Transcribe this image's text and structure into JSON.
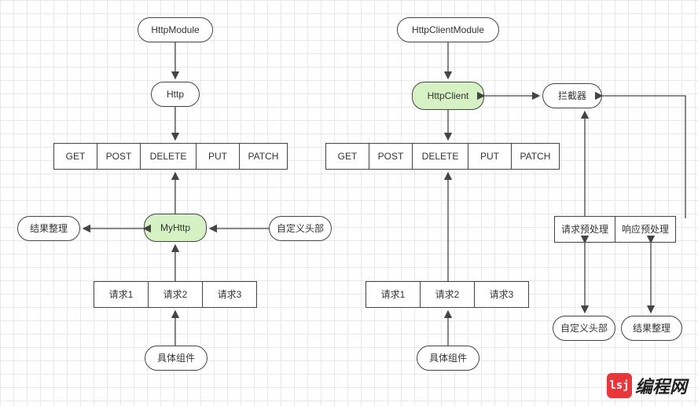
{
  "left": {
    "module": "HttpModule",
    "http": "Http",
    "methods": [
      "GET",
      "POST",
      "DELETE",
      "PUT",
      "PATCH"
    ],
    "myhttp": "MyHttp",
    "result_handling": "结果整理",
    "custom_header": "自定义头部",
    "requests": [
      "请求1",
      "请求2",
      "请求3"
    ],
    "component": "具体组件"
  },
  "right": {
    "module": "HttpClientModule",
    "client": "HttpClient",
    "interceptor": "拦截器",
    "methods": [
      "GET",
      "POST",
      "DELETE",
      "PUT",
      "PATCH"
    ],
    "requests": [
      "请求1",
      "请求2",
      "请求3"
    ],
    "component": "具体组件",
    "pre_request": "请求预处理",
    "pre_response": "响应预处理",
    "custom_header": "自定义头部",
    "result_handling": "结果整理"
  },
  "watermark": {
    "badge": "lsj",
    "text": "编程网"
  }
}
